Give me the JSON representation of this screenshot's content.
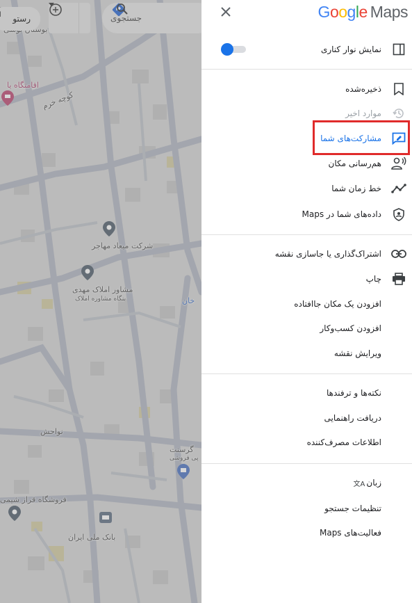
{
  "map": {
    "search_placeholder": "جستجوی",
    "filter_chip": "رستو",
    "labels": {
      "l1": "بوستان بوسی",
      "l2": "اقامتگاه یا",
      "l3": "کوچه خرم",
      "l4": "شرکت میعاد مهاجر",
      "l5": "مشاور املاک مهدی",
      "l6": "بنگاه مشاوره املاک",
      "l7": "خان",
      "l8": "نواحش",
      "l9": "گرسنت",
      "l10": "پی فروشی",
      "l11": "فروشگاه قراز شیمی",
      "l12": "بانک ملی ایران"
    }
  },
  "menu": {
    "logo": {
      "g1": "G",
      "o1": "o",
      "o2": "o",
      "g2": "g",
      "l": "l",
      "e": "e",
      "maps": "Maps"
    },
    "colors": {
      "blue": "#4285F4",
      "red": "#EA4335",
      "yellow": "#FBBC05",
      "green": "#34A853"
    },
    "show_sidebar": "نمایش نوار کناری",
    "group1": {
      "saved": "ذخیره‌شده",
      "recent": "موارد اخیر",
      "contributions": "مشارکت‌های شما",
      "location_sharing": "هم‌رسانی مکان",
      "timeline": "خط زمان شما",
      "your_data": "داده‌های شما در Maps"
    },
    "group2": {
      "share_embed": "اشتراک‌گذاری یا جاسازی نقشه",
      "print": "چاپ",
      "add_missing_place": "افزودن یک مکان جاافتاده",
      "add_business": "افزودن کسب‌وکار",
      "edit_map": "ویرایش نقشه"
    },
    "group3": {
      "tips": "نکته‌ها و ترفندها",
      "get_help": "دریافت راهنمایی",
      "consumer_info": "اطلاعات مصرف‌کننده"
    },
    "group4": {
      "language": "زبان",
      "search_settings": "تنظیمات جستجو",
      "maps_activity": "فعالیت‌های Maps"
    }
  }
}
